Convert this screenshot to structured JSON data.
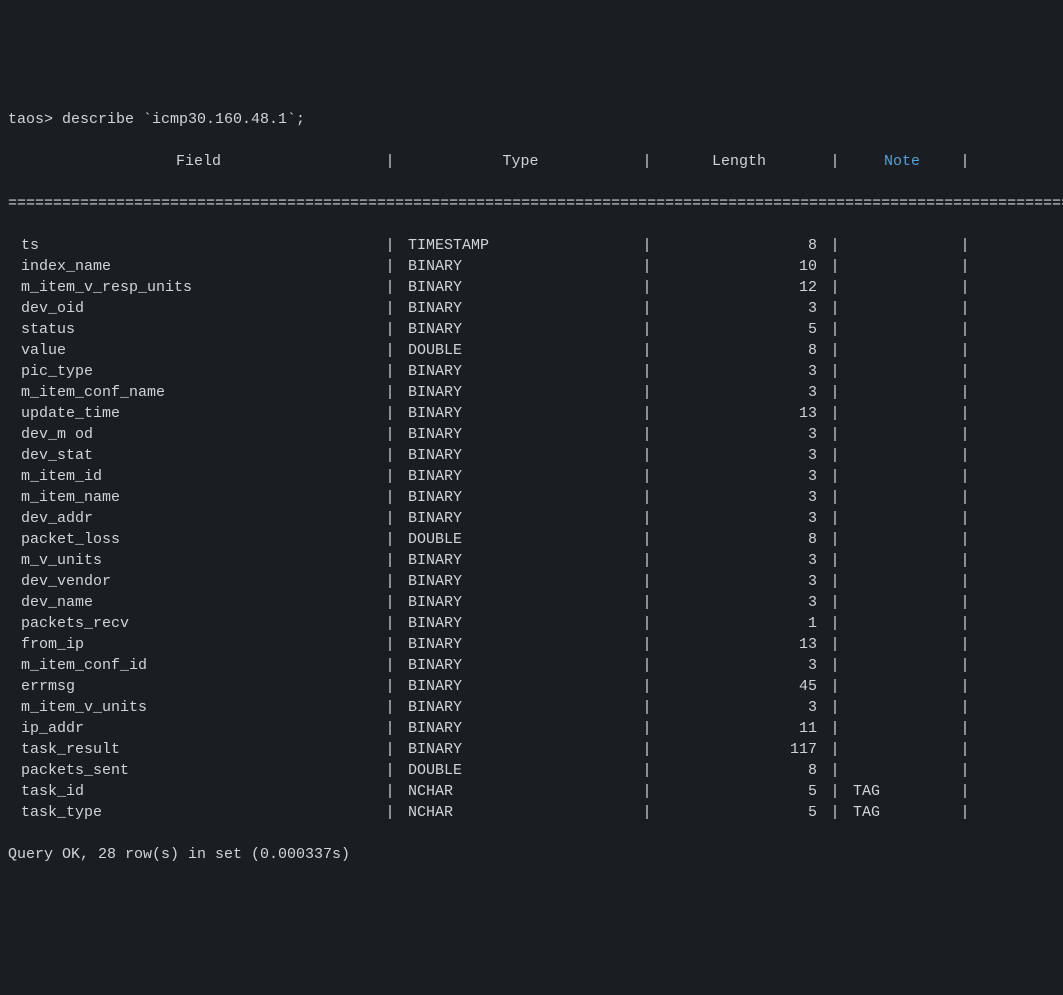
{
  "prompt": "taos> describe `icmp30.160.48.1`;",
  "headers": {
    "field": "Field",
    "type": "Type",
    "length": "Length",
    "note": "Note"
  },
  "divider": "========================================================================================================================",
  "rows": [
    {
      "field": "ts",
      "type": "TIMESTAMP",
      "length": "8",
      "note": ""
    },
    {
      "field": "index_name",
      "type": "BINARY",
      "length": "10",
      "note": ""
    },
    {
      "field": "m_item_v_resp_units",
      "type": "BINARY",
      "length": "12",
      "note": ""
    },
    {
      "field": "dev_oid",
      "type": "BINARY",
      "length": "3",
      "note": ""
    },
    {
      "field": "status",
      "type": "BINARY",
      "length": "5",
      "note": ""
    },
    {
      "field": "value",
      "type": "DOUBLE",
      "length": "8",
      "note": ""
    },
    {
      "field": "pic_type",
      "type": "BINARY",
      "length": "3",
      "note": ""
    },
    {
      "field": "m_item_conf_name",
      "type": "BINARY",
      "length": "3",
      "note": ""
    },
    {
      "field": "update_time",
      "type": "BINARY",
      "length": "13",
      "note": ""
    },
    {
      "field": "dev_m od",
      "type": "BINARY",
      "length": "3",
      "note": ""
    },
    {
      "field": "dev_stat",
      "type": "BINARY",
      "length": "3",
      "note": ""
    },
    {
      "field": "m_item_id",
      "type": "BINARY",
      "length": "3",
      "note": ""
    },
    {
      "field": "m_item_name",
      "type": "BINARY",
      "length": "3",
      "note": ""
    },
    {
      "field": "dev_addr",
      "type": "BINARY",
      "length": "3",
      "note": ""
    },
    {
      "field": "packet_loss",
      "type": "DOUBLE",
      "length": "8",
      "note": ""
    },
    {
      "field": "m_v_units",
      "type": "BINARY",
      "length": "3",
      "note": ""
    },
    {
      "field": "dev_vendor",
      "type": "BINARY",
      "length": "3",
      "note": ""
    },
    {
      "field": "dev_name",
      "type": "BINARY",
      "length": "3",
      "note": ""
    },
    {
      "field": "packets_recv",
      "type": "BINARY",
      "length": "1",
      "note": ""
    },
    {
      "field": "from_ip",
      "type": "BINARY",
      "length": "13",
      "note": ""
    },
    {
      "field": "m_item_conf_id",
      "type": "BINARY",
      "length": "3",
      "note": ""
    },
    {
      "field": "errmsg",
      "type": "BINARY",
      "length": "45",
      "note": ""
    },
    {
      "field": "m_item_v_units",
      "type": "BINARY",
      "length": "3",
      "note": ""
    },
    {
      "field": "ip_addr",
      "type": "BINARY",
      "length": "11",
      "note": ""
    },
    {
      "field": "task_result",
      "type": "BINARY",
      "length": "117",
      "note": ""
    },
    {
      "field": "packets_sent",
      "type": "DOUBLE",
      "length": "8",
      "note": ""
    },
    {
      "field": "task_id",
      "type": "NCHAR",
      "length": "5",
      "note": "TAG"
    },
    {
      "field": "task_type",
      "type": "NCHAR",
      "length": "5",
      "note": "TAG"
    }
  ],
  "status": "Query OK, 28 row(s) in set (0.000337s)"
}
